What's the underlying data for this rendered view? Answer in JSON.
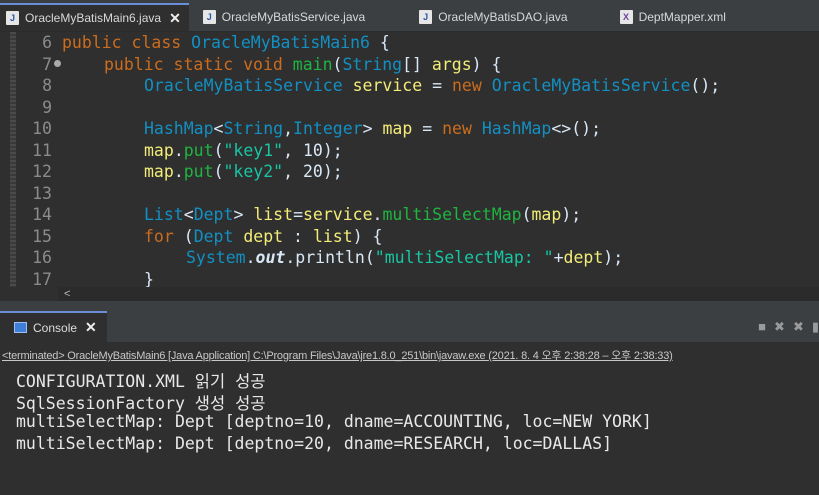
{
  "tabs": [
    {
      "label": "OracleMyBatisMain6.java",
      "type": "java",
      "active": true,
      "closable": true
    },
    {
      "label": "OracleMyBatisService.java",
      "type": "java",
      "active": false
    },
    {
      "label": "OracleMyBatisDAO.java",
      "type": "java",
      "active": false
    },
    {
      "label": "DeptMapper.xml",
      "type": "xml",
      "active": false
    }
  ],
  "icons": {
    "java": "J",
    "xml": "X",
    "close": "✕"
  },
  "editor": {
    "lines": [
      {
        "num": "6"
      },
      {
        "num": "7"
      },
      {
        "num": "8"
      },
      {
        "num": "9"
      },
      {
        "num": "10"
      },
      {
        "num": "11"
      },
      {
        "num": "12"
      },
      {
        "num": "13"
      },
      {
        "num": "14"
      },
      {
        "num": "15"
      },
      {
        "num": "16"
      },
      {
        "num": "17"
      }
    ],
    "tokens": {
      "l6": [
        "public",
        " ",
        "class",
        " ",
        "OracleMyBatisMain6",
        " {"
      ],
      "l7": [
        "public",
        " ",
        "static",
        " ",
        "void",
        " ",
        "main",
        "(",
        "String",
        "[] ",
        "args",
        ") {"
      ],
      "l8": [
        "OracleMyBatisService",
        " ",
        "service",
        " = ",
        "new",
        " ",
        "OracleMyBatisService",
        "();"
      ],
      "l10": [
        "HashMap",
        "<",
        "String",
        ",",
        "Integer",
        "> ",
        "map",
        " = ",
        "new",
        " ",
        "HashMap",
        "<>();"
      ],
      "l11": [
        "map",
        ".",
        "put",
        "(",
        "\"key1\"",
        ", ",
        "10",
        ");"
      ],
      "l12": [
        "map",
        ".",
        "put",
        "(",
        "\"key2\"",
        ", ",
        "20",
        ");"
      ],
      "l14": [
        "List",
        "<",
        "Dept",
        "> ",
        "list",
        "=",
        "service",
        ".",
        "multiSelectMap",
        "(",
        "map",
        ");"
      ],
      "l15": [
        "for",
        " (",
        "Dept",
        " ",
        "dept",
        " : ",
        "list",
        ") {"
      ],
      "l16": [
        "System",
        ".",
        "out",
        ".",
        "println",
        "(",
        "\"multiSelectMap: \"",
        "+",
        "dept",
        ");"
      ],
      "l17": [
        "}"
      ]
    },
    "hscroll_arrow": "<"
  },
  "console": {
    "tab_label": "Console",
    "terminated_prefix": "<terminated>",
    "terminated_text": "OracleMyBatisMain6 [Java Application] C:\\Program Files\\Java\\jre1.8.0_251\\bin\\javaw.exe",
    "terminated_time": "(2021. 8. 4 오후 2:38:28 – 오후 2:38:33)",
    "output": [
      "CONFIGURATION.XML 읽기 성공",
      "SqlSessionFactory 생성 성공",
      "multiSelectMap: Dept [deptno=10, dname=ACCOUNTING, loc=NEW YORK]",
      "multiSelectMap: Dept [deptno=20, dname=RESEARCH, loc=DALLAS]"
    ],
    "toolbar_icons": [
      "stop-icon",
      "remove-launch-icon",
      "remove-all-icon",
      "more-icon"
    ]
  }
}
